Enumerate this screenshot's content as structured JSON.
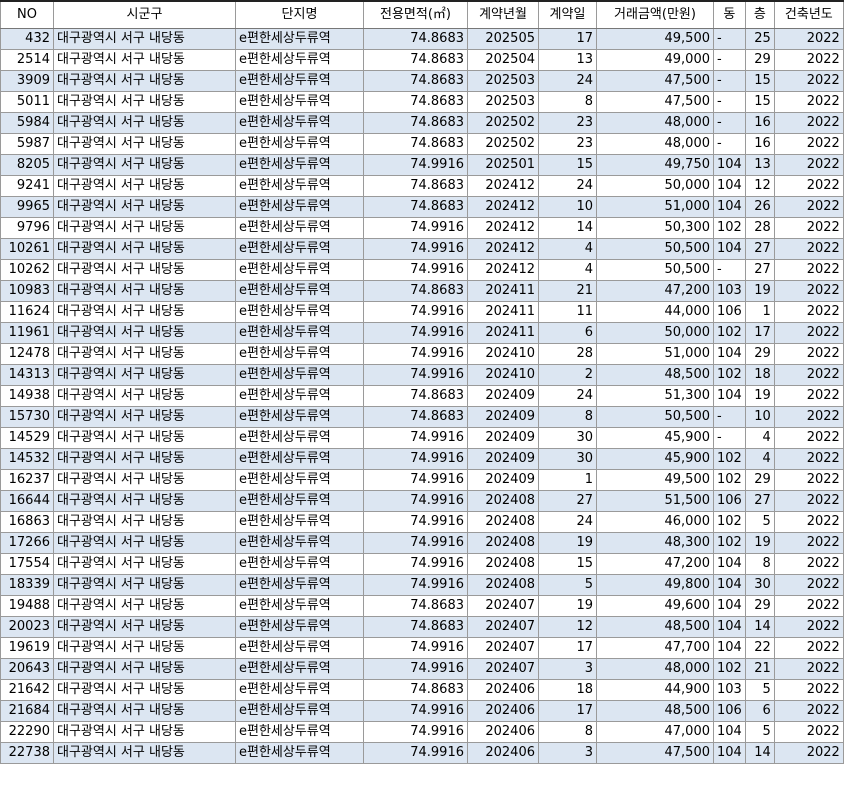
{
  "columns": [
    "NO",
    "시군구",
    "단지명",
    "전용면적(㎡)",
    "계약년월",
    "계약일",
    "거래금액(만원)",
    "동",
    "층",
    "건축년도"
  ],
  "rows": [
    [
      "432",
      "대구광역시 서구 내당동",
      "e편한세상두류역",
      "74.8683",
      "202505",
      "17",
      "49,500",
      "-",
      "25",
      "2022"
    ],
    [
      "2514",
      "대구광역시 서구 내당동",
      "e편한세상두류역",
      "74.8683",
      "202504",
      "13",
      "49,000",
      "-",
      "29",
      "2022"
    ],
    [
      "3909",
      "대구광역시 서구 내당동",
      "e편한세상두류역",
      "74.8683",
      "202503",
      "24",
      "47,500",
      "-",
      "15",
      "2022"
    ],
    [
      "5011",
      "대구광역시 서구 내당동",
      "e편한세상두류역",
      "74.8683",
      "202503",
      "8",
      "47,500",
      "-",
      "15",
      "2022"
    ],
    [
      "5984",
      "대구광역시 서구 내당동",
      "e편한세상두류역",
      "74.8683",
      "202502",
      "23",
      "48,000",
      "-",
      "16",
      "2022"
    ],
    [
      "5987",
      "대구광역시 서구 내당동",
      "e편한세상두류역",
      "74.8683",
      "202502",
      "23",
      "48,000",
      "-",
      "16",
      "2022"
    ],
    [
      "8205",
      "대구광역시 서구 내당동",
      "e편한세상두류역",
      "74.9916",
      "202501",
      "15",
      "49,750",
      "104",
      "13",
      "2022"
    ],
    [
      "9241",
      "대구광역시 서구 내당동",
      "e편한세상두류역",
      "74.8683",
      "202412",
      "24",
      "50,000",
      "104",
      "12",
      "2022"
    ],
    [
      "9965",
      "대구광역시 서구 내당동",
      "e편한세상두류역",
      "74.8683",
      "202412",
      "10",
      "51,000",
      "104",
      "26",
      "2022"
    ],
    [
      "9796",
      "대구광역시 서구 내당동",
      "e편한세상두류역",
      "74.9916",
      "202412",
      "14",
      "50,300",
      "102",
      "28",
      "2022"
    ],
    [
      "10261",
      "대구광역시 서구 내당동",
      "e편한세상두류역",
      "74.9916",
      "202412",
      "4",
      "50,500",
      "104",
      "27",
      "2022"
    ],
    [
      "10262",
      "대구광역시 서구 내당동",
      "e편한세상두류역",
      "74.9916",
      "202412",
      "4",
      "50,500",
      "-",
      "27",
      "2022"
    ],
    [
      "10983",
      "대구광역시 서구 내당동",
      "e편한세상두류역",
      "74.8683",
      "202411",
      "21",
      "47,200",
      "103",
      "19",
      "2022"
    ],
    [
      "11624",
      "대구광역시 서구 내당동",
      "e편한세상두류역",
      "74.9916",
      "202411",
      "11",
      "44,000",
      "106",
      "1",
      "2022"
    ],
    [
      "11961",
      "대구광역시 서구 내당동",
      "e편한세상두류역",
      "74.9916",
      "202411",
      "6",
      "50,000",
      "102",
      "17",
      "2022"
    ],
    [
      "12478",
      "대구광역시 서구 내당동",
      "e편한세상두류역",
      "74.9916",
      "202410",
      "28",
      "51,000",
      "104",
      "29",
      "2022"
    ],
    [
      "14313",
      "대구광역시 서구 내당동",
      "e편한세상두류역",
      "74.9916",
      "202410",
      "2",
      "48,500",
      "102",
      "18",
      "2022"
    ],
    [
      "14938",
      "대구광역시 서구 내당동",
      "e편한세상두류역",
      "74.8683",
      "202409",
      "24",
      "51,300",
      "104",
      "19",
      "2022"
    ],
    [
      "15730",
      "대구광역시 서구 내당동",
      "e편한세상두류역",
      "74.8683",
      "202409",
      "8",
      "50,500",
      "-",
      "10",
      "2022"
    ],
    [
      "14529",
      "대구광역시 서구 내당동",
      "e편한세상두류역",
      "74.9916",
      "202409",
      "30",
      "45,900",
      "-",
      "4",
      "2022"
    ],
    [
      "14532",
      "대구광역시 서구 내당동",
      "e편한세상두류역",
      "74.9916",
      "202409",
      "30",
      "45,900",
      "102",
      "4",
      "2022"
    ],
    [
      "16237",
      "대구광역시 서구 내당동",
      "e편한세상두류역",
      "74.9916",
      "202409",
      "1",
      "49,500",
      "102",
      "29",
      "2022"
    ],
    [
      "16644",
      "대구광역시 서구 내당동",
      "e편한세상두류역",
      "74.9916",
      "202408",
      "27",
      "51,500",
      "106",
      "27",
      "2022"
    ],
    [
      "16863",
      "대구광역시 서구 내당동",
      "e편한세상두류역",
      "74.9916",
      "202408",
      "24",
      "46,000",
      "102",
      "5",
      "2022"
    ],
    [
      "17266",
      "대구광역시 서구 내당동",
      "e편한세상두류역",
      "74.9916",
      "202408",
      "19",
      "48,300",
      "102",
      "19",
      "2022"
    ],
    [
      "17554",
      "대구광역시 서구 내당동",
      "e편한세상두류역",
      "74.9916",
      "202408",
      "15",
      "47,200",
      "104",
      "8",
      "2022"
    ],
    [
      "18339",
      "대구광역시 서구 내당동",
      "e편한세상두류역",
      "74.9916",
      "202408",
      "5",
      "49,800",
      "104",
      "30",
      "2022"
    ],
    [
      "19488",
      "대구광역시 서구 내당동",
      "e편한세상두류역",
      "74.8683",
      "202407",
      "19",
      "49,600",
      "104",
      "29",
      "2022"
    ],
    [
      "20023",
      "대구광역시 서구 내당동",
      "e편한세상두류역",
      "74.8683",
      "202407",
      "12",
      "48,500",
      "104",
      "14",
      "2022"
    ],
    [
      "19619",
      "대구광역시 서구 내당동",
      "e편한세상두류역",
      "74.9916",
      "202407",
      "17",
      "47,700",
      "104",
      "22",
      "2022"
    ],
    [
      "20643",
      "대구광역시 서구 내당동",
      "e편한세상두류역",
      "74.9916",
      "202407",
      "3",
      "48,000",
      "102",
      "21",
      "2022"
    ],
    [
      "21642",
      "대구광역시 서구 내당동",
      "e편한세상두류역",
      "74.8683",
      "202406",
      "18",
      "44,900",
      "103",
      "5",
      "2022"
    ],
    [
      "21684",
      "대구광역시 서구 내당동",
      "e편한세상두류역",
      "74.9916",
      "202406",
      "17",
      "48,500",
      "106",
      "6",
      "2022"
    ],
    [
      "22290",
      "대구광역시 서구 내당동",
      "e편한세상두류역",
      "74.9916",
      "202406",
      "8",
      "47,000",
      "104",
      "5",
      "2022"
    ],
    [
      "22738",
      "대구광역시 서구 내당동",
      "e편한세상두류역",
      "74.9916",
      "202406",
      "3",
      "47,500",
      "104",
      "14",
      "2022"
    ]
  ]
}
